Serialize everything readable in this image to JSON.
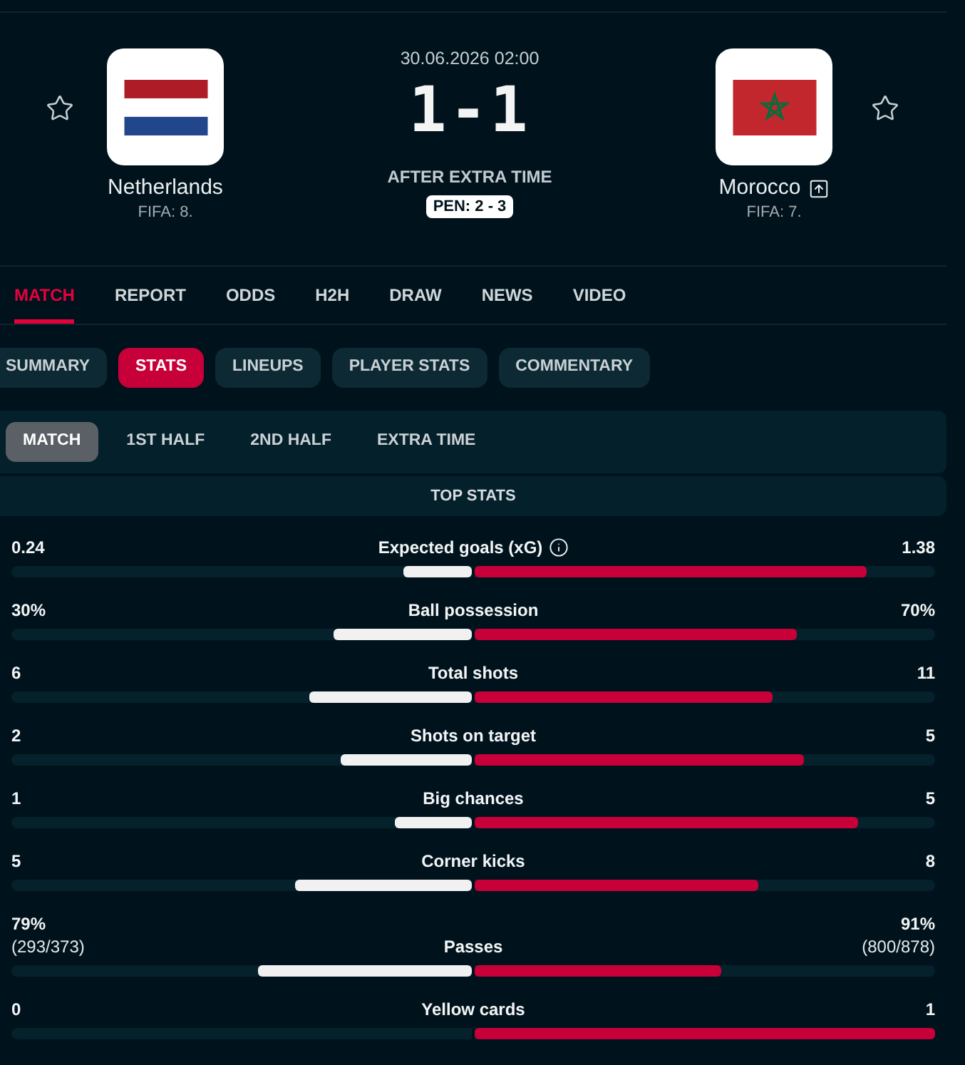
{
  "teams": [
    {
      "name": "Netherlands",
      "fifa": "FIFA: 8.",
      "kind": "tricolor",
      "favorite": false,
      "advances": false
    },
    {
      "name": "Morocco",
      "fifa": "FIFA: 7.",
      "kind": "emblem",
      "favorite": false,
      "advances": true
    }
  ],
  "match": {
    "date": "30.06.2026 02:00",
    "score": "1-1",
    "status": "AFTER EXTRA TIME",
    "penalties": "PEN: 2 - 3"
  },
  "nav_tabs": [
    {
      "label": "MATCH",
      "selected": true
    },
    {
      "label": "REPORT",
      "selected": false
    },
    {
      "label": "ODDS",
      "selected": false
    },
    {
      "label": "H2H",
      "selected": false
    },
    {
      "label": "DRAW",
      "selected": false
    },
    {
      "label": "NEWS",
      "selected": false
    },
    {
      "label": "VIDEO",
      "selected": false
    }
  ],
  "sub_tabs": [
    {
      "label": "SUMMARY",
      "selected": false
    },
    {
      "label": "STATS",
      "selected": true
    },
    {
      "label": "LINEUPS",
      "selected": false
    },
    {
      "label": "PLAYER STATS",
      "selected": false
    },
    {
      "label": "COMMENTARY",
      "selected": false
    }
  ],
  "periods": [
    {
      "label": "MATCH",
      "selected": true
    },
    {
      "label": "1ST HALF",
      "selected": false
    },
    {
      "label": "2ND HALF",
      "selected": false
    },
    {
      "label": "EXTRA TIME",
      "selected": false
    }
  ],
  "section_title": "TOP STATS",
  "stats": [
    {
      "label": "Expected goals (xG)",
      "info": true,
      "home": {
        "value": "0.24",
        "level": 0.148
      },
      "away": {
        "value": "1.38",
        "level": 0.852
      }
    },
    {
      "label": "Ball possession",
      "info": false,
      "home": {
        "value": "30%",
        "level": 0.3
      },
      "away": {
        "value": "70%",
        "level": 0.7
      }
    },
    {
      "label": "Total shots",
      "info": false,
      "home": {
        "value": "6",
        "level": 0.353
      },
      "away": {
        "value": "11",
        "level": 0.647
      }
    },
    {
      "label": "Shots on target",
      "info": false,
      "home": {
        "value": "2",
        "level": 0.286
      },
      "away": {
        "value": "5",
        "level": 0.714
      }
    },
    {
      "label": "Big chances",
      "info": false,
      "home": {
        "value": "1",
        "level": 0.167
      },
      "away": {
        "value": "5",
        "level": 0.833
      }
    },
    {
      "label": "Corner kicks",
      "info": false,
      "home": {
        "value": "5",
        "level": 0.385
      },
      "away": {
        "value": "8",
        "level": 0.615
      }
    },
    {
      "label": "Passes",
      "info": false,
      "home": {
        "value": "79%",
        "detail": "(293/373)",
        "level": 0.465
      },
      "away": {
        "value": "91%",
        "detail": "(800/878)",
        "level": 0.535
      }
    },
    {
      "label": "Yellow cards",
      "info": false,
      "home": {
        "value": "0",
        "level": 0
      },
      "away": {
        "value": "1",
        "level": 1
      }
    }
  ]
}
